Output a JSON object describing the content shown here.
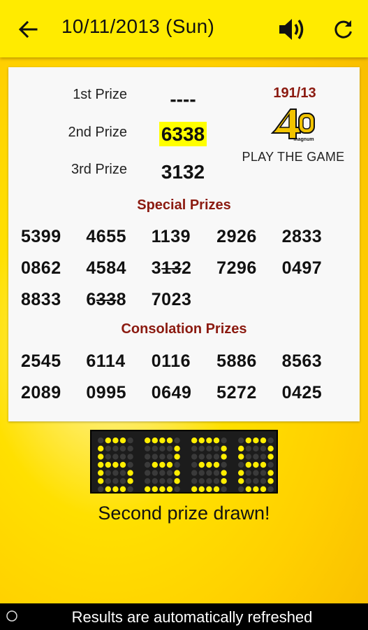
{
  "header": {
    "title": "10/11/2013 (Sun)",
    "back_icon": "arrow-left-icon",
    "sound_icon": "volume-icon",
    "refresh_icon": "refresh-icon"
  },
  "results": {
    "first": {
      "label": "1st Prize",
      "value": "----"
    },
    "second": {
      "label": "2nd Prize",
      "value": "6338"
    },
    "third": {
      "label": "3rd Prize",
      "value": "3132"
    },
    "draw_number": "191/13",
    "logo_text": "magnum",
    "logo_mark": "4D",
    "play_label": "PLAY THE GAME",
    "special_title": "Special Prizes",
    "special": [
      [
        "5399",
        "4655",
        "1139",
        "2926",
        "2833"
      ],
      [
        "0862",
        "4584",
        "3132",
        "7296",
        "0497"
      ],
      [
        "8833",
        "6338",
        "7023",
        "",
        ""
      ]
    ],
    "special_struck": [
      "3132",
      "6338"
    ],
    "consolation_title": "Consolation Prizes",
    "consolation": [
      [
        "2545",
        "6114",
        "0116",
        "5886",
        "8563"
      ],
      [
        "2089",
        "0995",
        "0649",
        "5272",
        "0425"
      ]
    ]
  },
  "display": {
    "led_digits": "6338",
    "status": "Second prize drawn!"
  },
  "footer": {
    "message": "Results are automatically refreshed"
  },
  "colors": {
    "appbar": "#ffeb00",
    "highlight": "#ffff00",
    "section_title": "#8b1a10",
    "led_on": "#ffee00",
    "led_off": "#3a3a3a"
  }
}
